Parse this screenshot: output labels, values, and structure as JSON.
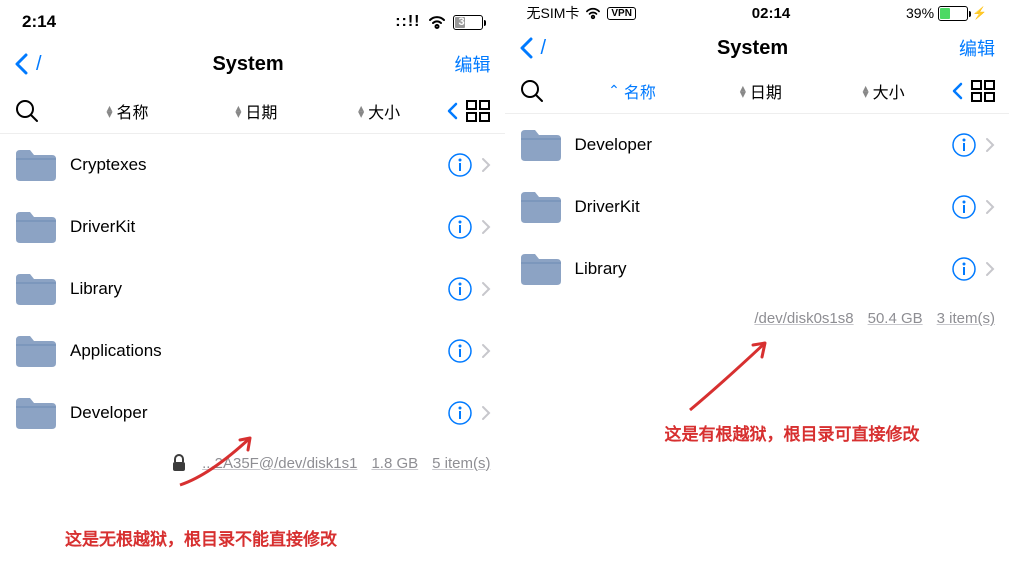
{
  "left": {
    "status": {
      "time": "2:14",
      "battery_pct": "39"
    },
    "nav": {
      "back": "/",
      "title": "System",
      "edit": "编辑"
    },
    "sort": {
      "name": "名称",
      "date": "日期",
      "size": "大小"
    },
    "files": [
      {
        "name": "Cryptexes"
      },
      {
        "name": "DriverKit"
      },
      {
        "name": "Library"
      },
      {
        "name": "Applications"
      },
      {
        "name": "Developer"
      }
    ],
    "footer": {
      "path": "...2A35F@/dev/disk1s1",
      "size": "1.8 GB",
      "count": "5 item(s)"
    },
    "annotation": "这是无根越狱，根目录不能直接修改"
  },
  "right": {
    "status": {
      "sim": "无SIM卡",
      "vpn": "VPN",
      "time": "02:14",
      "battery_pct": "39%"
    },
    "nav": {
      "back": "/",
      "title": "System",
      "edit": "编辑"
    },
    "sort": {
      "name": "名称",
      "date": "日期",
      "size": "大小"
    },
    "files": [
      {
        "name": "Developer"
      },
      {
        "name": "DriverKit"
      },
      {
        "name": "Library"
      }
    ],
    "footer": {
      "path": "/dev/disk0s1s8",
      "size": "50.4 GB",
      "count": "3 item(s)"
    },
    "annotation": "这是有根越狱，根目录可直接修改"
  }
}
